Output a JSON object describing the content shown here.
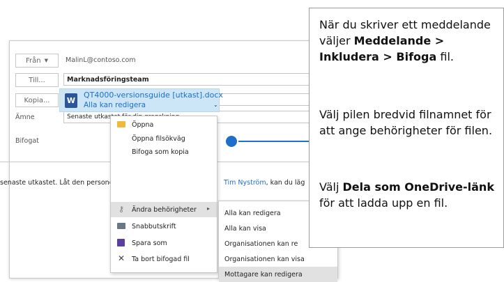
{
  "compose": {
    "from_button": "Från",
    "from_value": "MalinL@contoso.com",
    "to_button": "Till...",
    "to_value": "Marknadsföringsteam",
    "cc_button": "Kopia...",
    "cc_value": "",
    "subject_label": "Ämne",
    "subject_value": "Senaste utkastet för din granskning",
    "attached_label": "Bifogat",
    "attachment_name": "QT4000-versionsguide [utkast].docx",
    "attachment_permission": "Alla kan redigera",
    "body_text_start": "senaste utkastet. Låt den personer",
    "body_mention": "Tim Nyström",
    "body_text_end": ", kan du läg"
  },
  "context_menu": {
    "items": [
      {
        "label": "Öppna",
        "icon": "folder-icon"
      },
      {
        "label": "Öppna filsökväg",
        "icon": ""
      },
      {
        "label": "Bifoga som kopia",
        "icon": ""
      },
      {
        "label": "Ändra behörigheter",
        "icon": "key-icon"
      },
      {
        "label": "Snabbutskrift",
        "icon": "printer-icon"
      },
      {
        "label": "Spara som",
        "icon": "save-icon"
      },
      {
        "label": "Ta bort bifogad fil",
        "icon": "close-icon"
      }
    ]
  },
  "submenu": {
    "items": [
      "Alla kan redigera",
      "Alla kan visa",
      "Organisationen kan re",
      "Organisationen kan visa",
      "Mottagare kan redigera"
    ]
  },
  "callout": {
    "p1_a": "När du skriver ett meddelande väljer ",
    "p1_b": "Meddelande > Inkludera > Bifoga",
    "p1_c": " fil.",
    "p2": "Välj pilen bredvid filnamnet för att ange behörigheter för filen.",
    "p3_a": "Välj ",
    "p3_b": "Dela som OneDrive-länk",
    "p3_c": " för att ladda upp en fil."
  },
  "colors": {
    "accent_blue": "#1d6fc9",
    "attachment_bg": "#cde6f7",
    "word_blue": "#2b579a"
  }
}
